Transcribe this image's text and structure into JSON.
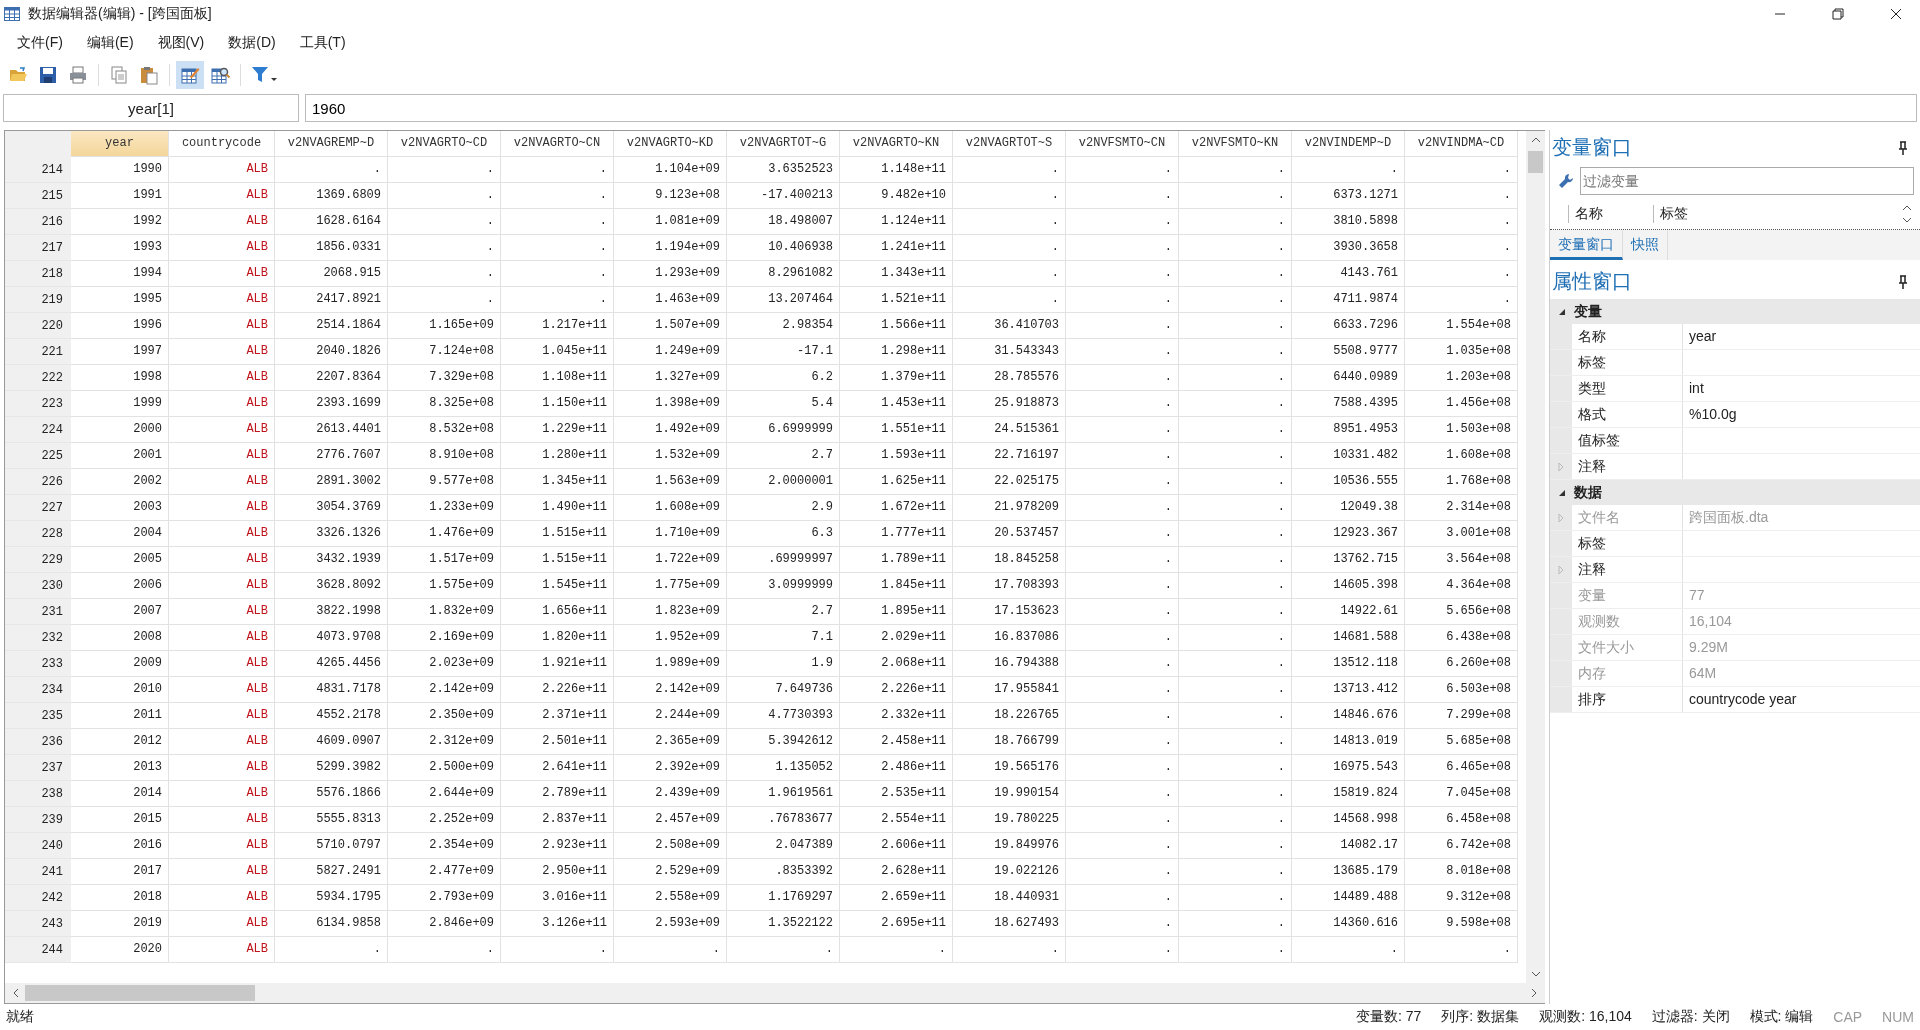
{
  "window": {
    "title": "数据编辑器(编辑) - [跨国面板]"
  },
  "menu": [
    "文件(F)",
    "编辑(E)",
    "视图(V)",
    "数据(D)",
    "工具(T)"
  ],
  "toolbar": [
    {
      "kind": "open",
      "selected": false
    },
    {
      "kind": "save",
      "selected": false
    },
    {
      "kind": "print",
      "selected": false
    },
    {
      "kind": "copy",
      "selected": false
    },
    {
      "kind": "paste",
      "selected": false
    },
    {
      "kind": "edit",
      "selected": true
    },
    {
      "kind": "browse",
      "selected": false
    },
    {
      "kind": "filter",
      "selected": false
    }
  ],
  "cell_bar": {
    "name": "year[1]",
    "value": "1960"
  },
  "table": {
    "columns": [
      {
        "label": "year",
        "kind": "numeric",
        "selected": true
      },
      {
        "label": "countrycode",
        "kind": "string",
        "selected": false
      },
      {
        "label": "v2NVAGREMP~D",
        "kind": "numeric",
        "selected": false
      },
      {
        "label": "v2NVAGRTO~CD",
        "kind": "numeric",
        "selected": false
      },
      {
        "label": "v2NVAGRTO~CN",
        "kind": "numeric",
        "selected": false
      },
      {
        "label": "v2NVAGRTO~KD",
        "kind": "numeric",
        "selected": false
      },
      {
        "label": "v2NVAGRTOT~G",
        "kind": "numeric",
        "selected": false
      },
      {
        "label": "v2NVAGRTO~KN",
        "kind": "numeric",
        "selected": false
      },
      {
        "label": "v2NVAGRTOT~S",
        "kind": "numeric",
        "selected": false
      },
      {
        "label": "v2NVFSMTO~CN",
        "kind": "numeric",
        "selected": false
      },
      {
        "label": "v2NVFSMTO~KN",
        "kind": "numeric",
        "selected": false
      },
      {
        "label": "v2NVINDEMP~D",
        "kind": "numeric",
        "selected": false
      },
      {
        "label": "v2NVINDMA~CD",
        "kind": "numeric",
        "selected": false
      }
    ],
    "rows": [
      {
        "n": "214",
        "cells": [
          "1990",
          "ALB",
          ".",
          ".",
          ".",
          "1.104e+09",
          "3.6352523",
          "1.148e+11",
          ".",
          ".",
          ".",
          ".",
          "."
        ]
      },
      {
        "n": "215",
        "cells": [
          "1991",
          "ALB",
          "1369.6809",
          ".",
          ".",
          "9.123e+08",
          "-17.400213",
          "9.482e+10",
          ".",
          ".",
          ".",
          "6373.1271",
          "."
        ]
      },
      {
        "n": "216",
        "cells": [
          "1992",
          "ALB",
          "1628.6164",
          ".",
          ".",
          "1.081e+09",
          "18.498007",
          "1.124e+11",
          ".",
          ".",
          ".",
          "3810.5898",
          "."
        ]
      },
      {
        "n": "217",
        "cells": [
          "1993",
          "ALB",
          "1856.0331",
          ".",
          ".",
          "1.194e+09",
          "10.406938",
          "1.241e+11",
          ".",
          ".",
          ".",
          "3930.3658",
          "."
        ]
      },
      {
        "n": "218",
        "cells": [
          "1994",
          "ALB",
          "2068.915",
          ".",
          ".",
          "1.293e+09",
          "8.2961082",
          "1.343e+11",
          ".",
          ".",
          ".",
          "4143.761",
          "."
        ]
      },
      {
        "n": "219",
        "cells": [
          "1995",
          "ALB",
          "2417.8921",
          ".",
          ".",
          "1.463e+09",
          "13.207464",
          "1.521e+11",
          ".",
          ".",
          ".",
          "4711.9874",
          "."
        ]
      },
      {
        "n": "220",
        "cells": [
          "1996",
          "ALB",
          "2514.1864",
          "1.165e+09",
          "1.217e+11",
          "1.507e+09",
          "2.98354",
          "1.566e+11",
          "36.410703",
          ".",
          ".",
          "6633.7296",
          "1.554e+08"
        ]
      },
      {
        "n": "221",
        "cells": [
          "1997",
          "ALB",
          "2040.1826",
          "7.124e+08",
          "1.045e+11",
          "1.249e+09",
          "-17.1",
          "1.298e+11",
          "31.543343",
          ".",
          ".",
          "5508.9777",
          "1.035e+08"
        ]
      },
      {
        "n": "222",
        "cells": [
          "1998",
          "ALB",
          "2207.8364",
          "7.329e+08",
          "1.108e+11",
          "1.327e+09",
          "6.2",
          "1.379e+11",
          "28.785576",
          ".",
          ".",
          "6440.0989",
          "1.203e+08"
        ]
      },
      {
        "n": "223",
        "cells": [
          "1999",
          "ALB",
          "2393.1699",
          "8.325e+08",
          "1.150e+11",
          "1.398e+09",
          "5.4",
          "1.453e+11",
          "25.918873",
          ".",
          ".",
          "7588.4395",
          "1.456e+08"
        ]
      },
      {
        "n": "224",
        "cells": [
          "2000",
          "ALB",
          "2613.4401",
          "8.532e+08",
          "1.229e+11",
          "1.492e+09",
          "6.6999999",
          "1.551e+11",
          "24.515361",
          ".",
          ".",
          "8951.4953",
          "1.503e+08"
        ]
      },
      {
        "n": "225",
        "cells": [
          "2001",
          "ALB",
          "2776.7607",
          "8.910e+08",
          "1.280e+11",
          "1.532e+09",
          "2.7",
          "1.593e+11",
          "22.716197",
          ".",
          ".",
          "10331.482",
          "1.608e+08"
        ]
      },
      {
        "n": "226",
        "cells": [
          "2002",
          "ALB",
          "2891.3002",
          "9.577e+08",
          "1.345e+11",
          "1.563e+09",
          "2.0000001",
          "1.625e+11",
          "22.025175",
          ".",
          ".",
          "10536.555",
          "1.768e+08"
        ]
      },
      {
        "n": "227",
        "cells": [
          "2003",
          "ALB",
          "3054.3769",
          "1.233e+09",
          "1.490e+11",
          "1.608e+09",
          "2.9",
          "1.672e+11",
          "21.978209",
          ".",
          ".",
          "12049.38",
          "2.314e+08"
        ]
      },
      {
        "n": "228",
        "cells": [
          "2004",
          "ALB",
          "3326.1326",
          "1.476e+09",
          "1.515e+11",
          "1.710e+09",
          "6.3",
          "1.777e+11",
          "20.537457",
          ".",
          ".",
          "12923.367",
          "3.001e+08"
        ]
      },
      {
        "n": "229",
        "cells": [
          "2005",
          "ALB",
          "3432.1939",
          "1.517e+09",
          "1.515e+11",
          "1.722e+09",
          ".69999997",
          "1.789e+11",
          "18.845258",
          ".",
          ".",
          "13762.715",
          "3.564e+08"
        ]
      },
      {
        "n": "230",
        "cells": [
          "2006",
          "ALB",
          "3628.8092",
          "1.575e+09",
          "1.545e+11",
          "1.775e+09",
          "3.0999999",
          "1.845e+11",
          "17.708393",
          ".",
          ".",
          "14605.398",
          "4.364e+08"
        ]
      },
      {
        "n": "231",
        "cells": [
          "2007",
          "ALB",
          "3822.1998",
          "1.832e+09",
          "1.656e+11",
          "1.823e+09",
          "2.7",
          "1.895e+11",
          "17.153623",
          ".",
          ".",
          "14922.61",
          "5.656e+08"
        ]
      },
      {
        "n": "232",
        "cells": [
          "2008",
          "ALB",
          "4073.9708",
          "2.169e+09",
          "1.820e+11",
          "1.952e+09",
          "7.1",
          "2.029e+11",
          "16.837086",
          ".",
          ".",
          "14681.588",
          "6.438e+08"
        ]
      },
      {
        "n": "233",
        "cells": [
          "2009",
          "ALB",
          "4265.4456",
          "2.023e+09",
          "1.921e+11",
          "1.989e+09",
          "1.9",
          "2.068e+11",
          "16.794388",
          ".",
          ".",
          "13512.118",
          "6.260e+08"
        ]
      },
      {
        "n": "234",
        "cells": [
          "2010",
          "ALB",
          "4831.7178",
          "2.142e+09",
          "2.226e+11",
          "2.142e+09",
          "7.649736",
          "2.226e+11",
          "17.955841",
          ".",
          ".",
          "13713.412",
          "6.503e+08"
        ]
      },
      {
        "n": "235",
        "cells": [
          "2011",
          "ALB",
          "4552.2178",
          "2.350e+09",
          "2.371e+11",
          "2.244e+09",
          "4.7730393",
          "2.332e+11",
          "18.226765",
          ".",
          ".",
          "14846.676",
          "7.299e+08"
        ]
      },
      {
        "n": "236",
        "cells": [
          "2012",
          "ALB",
          "4609.0907",
          "2.312e+09",
          "2.501e+11",
          "2.365e+09",
          "5.3942612",
          "2.458e+11",
          "18.766799",
          ".",
          ".",
          "14813.019",
          "5.685e+08"
        ]
      },
      {
        "n": "237",
        "cells": [
          "2013",
          "ALB",
          "5299.3982",
          "2.500e+09",
          "2.641e+11",
          "2.392e+09",
          "1.135052",
          "2.486e+11",
          "19.565176",
          ".",
          ".",
          "16975.543",
          "6.465e+08"
        ]
      },
      {
        "n": "238",
        "cells": [
          "2014",
          "ALB",
          "5576.1866",
          "2.644e+09",
          "2.789e+11",
          "2.439e+09",
          "1.9619561",
          "2.535e+11",
          "19.990154",
          ".",
          ".",
          "15819.824",
          "7.045e+08"
        ]
      },
      {
        "n": "239",
        "cells": [
          "2015",
          "ALB",
          "5555.8313",
          "2.252e+09",
          "2.837e+11",
          "2.457e+09",
          ".76783677",
          "2.554e+11",
          "19.780225",
          ".",
          ".",
          "14568.998",
          "6.458e+08"
        ]
      },
      {
        "n": "240",
        "cells": [
          "2016",
          "ALB",
          "5710.0797",
          "2.354e+09",
          "2.923e+11",
          "2.508e+09",
          "2.047389",
          "2.606e+11",
          "19.849976",
          ".",
          ".",
          "14082.17",
          "6.742e+08"
        ]
      },
      {
        "n": "241",
        "cells": [
          "2017",
          "ALB",
          "5827.2491",
          "2.477e+09",
          "2.950e+11",
          "2.529e+09",
          ".8353392",
          "2.628e+11",
          "19.022126",
          ".",
          ".",
          "13685.179",
          "8.018e+08"
        ]
      },
      {
        "n": "242",
        "cells": [
          "2018",
          "ALB",
          "5934.1795",
          "2.793e+09",
          "3.016e+11",
          "2.558e+09",
          "1.1769297",
          "2.659e+11",
          "18.440931",
          ".",
          ".",
          "14489.488",
          "9.312e+08"
        ]
      },
      {
        "n": "243",
        "cells": [
          "2019",
          "ALB",
          "6134.9858",
          "2.846e+09",
          "3.126e+11",
          "2.593e+09",
          "1.3522122",
          "2.695e+11",
          "18.627493",
          ".",
          ".",
          "14360.616",
          "9.598e+08"
        ]
      },
      {
        "n": "244",
        "cells": [
          "2020",
          "ALB",
          ".",
          ".",
          ".",
          ".",
          ".",
          ".",
          ".",
          ".",
          ".",
          ".",
          "."
        ]
      }
    ]
  },
  "variables_window": {
    "title": "变量窗口",
    "filter": {
      "placeholder": "过滤变量"
    },
    "columns": [
      "名称",
      "标签"
    ],
    "tabs": [
      {
        "label": "变量窗口",
        "selected": true
      },
      {
        "label": "快照",
        "selected": false
      }
    ]
  },
  "properties": {
    "title": "属性窗口",
    "groups": [
      {
        "label": "变量",
        "expanded": true,
        "rows": [
          {
            "name": "名称",
            "value": "year",
            "disabled": false,
            "expandable": false
          },
          {
            "name": "标签",
            "disabled": false,
            "expandable": false
          },
          {
            "name": "类型",
            "value": "int",
            "disabled": false,
            "expandable": false
          },
          {
            "name": "格式",
            "value": "%10.0g",
            "disabled": false,
            "expandable": false
          },
          {
            "name": "值标签",
            "disabled": false,
            "expandable": false
          },
          {
            "name": "注释",
            "disabled": false,
            "expandable": true
          }
        ]
      },
      {
        "label": "数据",
        "expanded": true,
        "rows": [
          {
            "name": "文件名",
            "value": "跨国面板.dta",
            "disabled": true,
            "expandable": true
          },
          {
            "name": "标签",
            "disabled": false,
            "expandable": false
          },
          {
            "name": "注释",
            "disabled": false,
            "expandable": true
          },
          {
            "name": "变量",
            "value": "77",
            "disabled": true,
            "expandable": false
          },
          {
            "name": "观测数",
            "value": "16,104",
            "disabled": true,
            "expandable": false
          },
          {
            "name": "文件大小",
            "value": "9.29M",
            "disabled": true,
            "expandable": false
          },
          {
            "name": "内存",
            "value": "64M",
            "disabled": true,
            "expandable": false
          },
          {
            "name": "排序",
            "value": "countrycode year",
            "disabled": false,
            "expandable": false
          }
        ]
      }
    ]
  },
  "status_bar": {
    "message": "就绪",
    "items": [
      {
        "text": "变量数: 77",
        "disabled": false
      },
      {
        "text": "列序: 数据集",
        "disabled": false
      },
      {
        "text": "观测数: 16,104",
        "disabled": false
      },
      {
        "text": "过滤器: 关闭",
        "disabled": false
      },
      {
        "text": "模式: 编辑",
        "disabled": false
      },
      {
        "text": "CAP",
        "disabled": true
      },
      {
        "text": "NUM",
        "disabled": true
      }
    ]
  }
}
